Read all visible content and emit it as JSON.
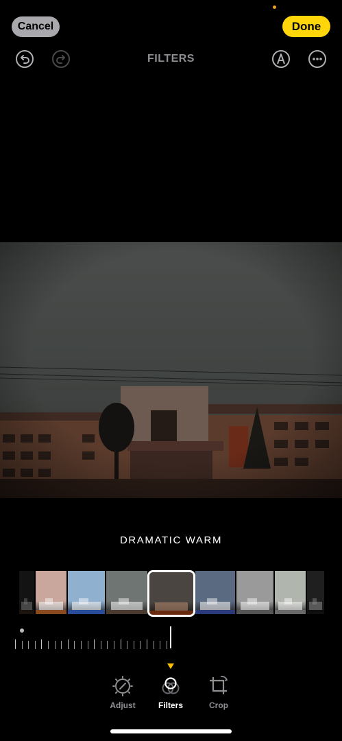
{
  "header": {
    "cancel_label": "Cancel",
    "done_label": "Done",
    "title": "FILTERS"
  },
  "icons": {
    "undo": "undo-icon",
    "redo": "redo-icon",
    "markup": "markup-pen-icon",
    "more": "more-icon"
  },
  "filter": {
    "selected_name": "DRAMATIC WARM",
    "thumbnails": [
      {
        "name": "vivid-warm",
        "tint": "#c9a79d",
        "ground": "#8a4a20"
      },
      {
        "name": "vivid-cool",
        "tint": "#8fb0cf",
        "ground": "#2a4a9a"
      },
      {
        "name": "dramatic",
        "tint": "#6f7573",
        "ground": "#4a3a30"
      },
      {
        "name": "dramatic-warm",
        "tint": "#4a4540",
        "ground": "#6a2a10"
      },
      {
        "name": "dramatic-cool",
        "tint": "#5a6a80",
        "ground": "#2a3a7a"
      },
      {
        "name": "mono",
        "tint": "#9a9a9a",
        "ground": "#555555"
      },
      {
        "name": "silvertone",
        "tint": "#b0b5ad",
        "ground": "#6a6a6a"
      },
      {
        "name": "noir",
        "tint": "#3a3a3a",
        "ground": "#1a1a1a"
      }
    ],
    "intensity": 1.0
  },
  "tools": {
    "adjust_label": "Adjust",
    "filters_label": "Filters",
    "crop_label": "Crop",
    "active": "Filters"
  },
  "colors": {
    "accent_yellow": "#ffd60a",
    "marker_yellow": "#ffc107",
    "muted_gray": "#8e8e93"
  }
}
